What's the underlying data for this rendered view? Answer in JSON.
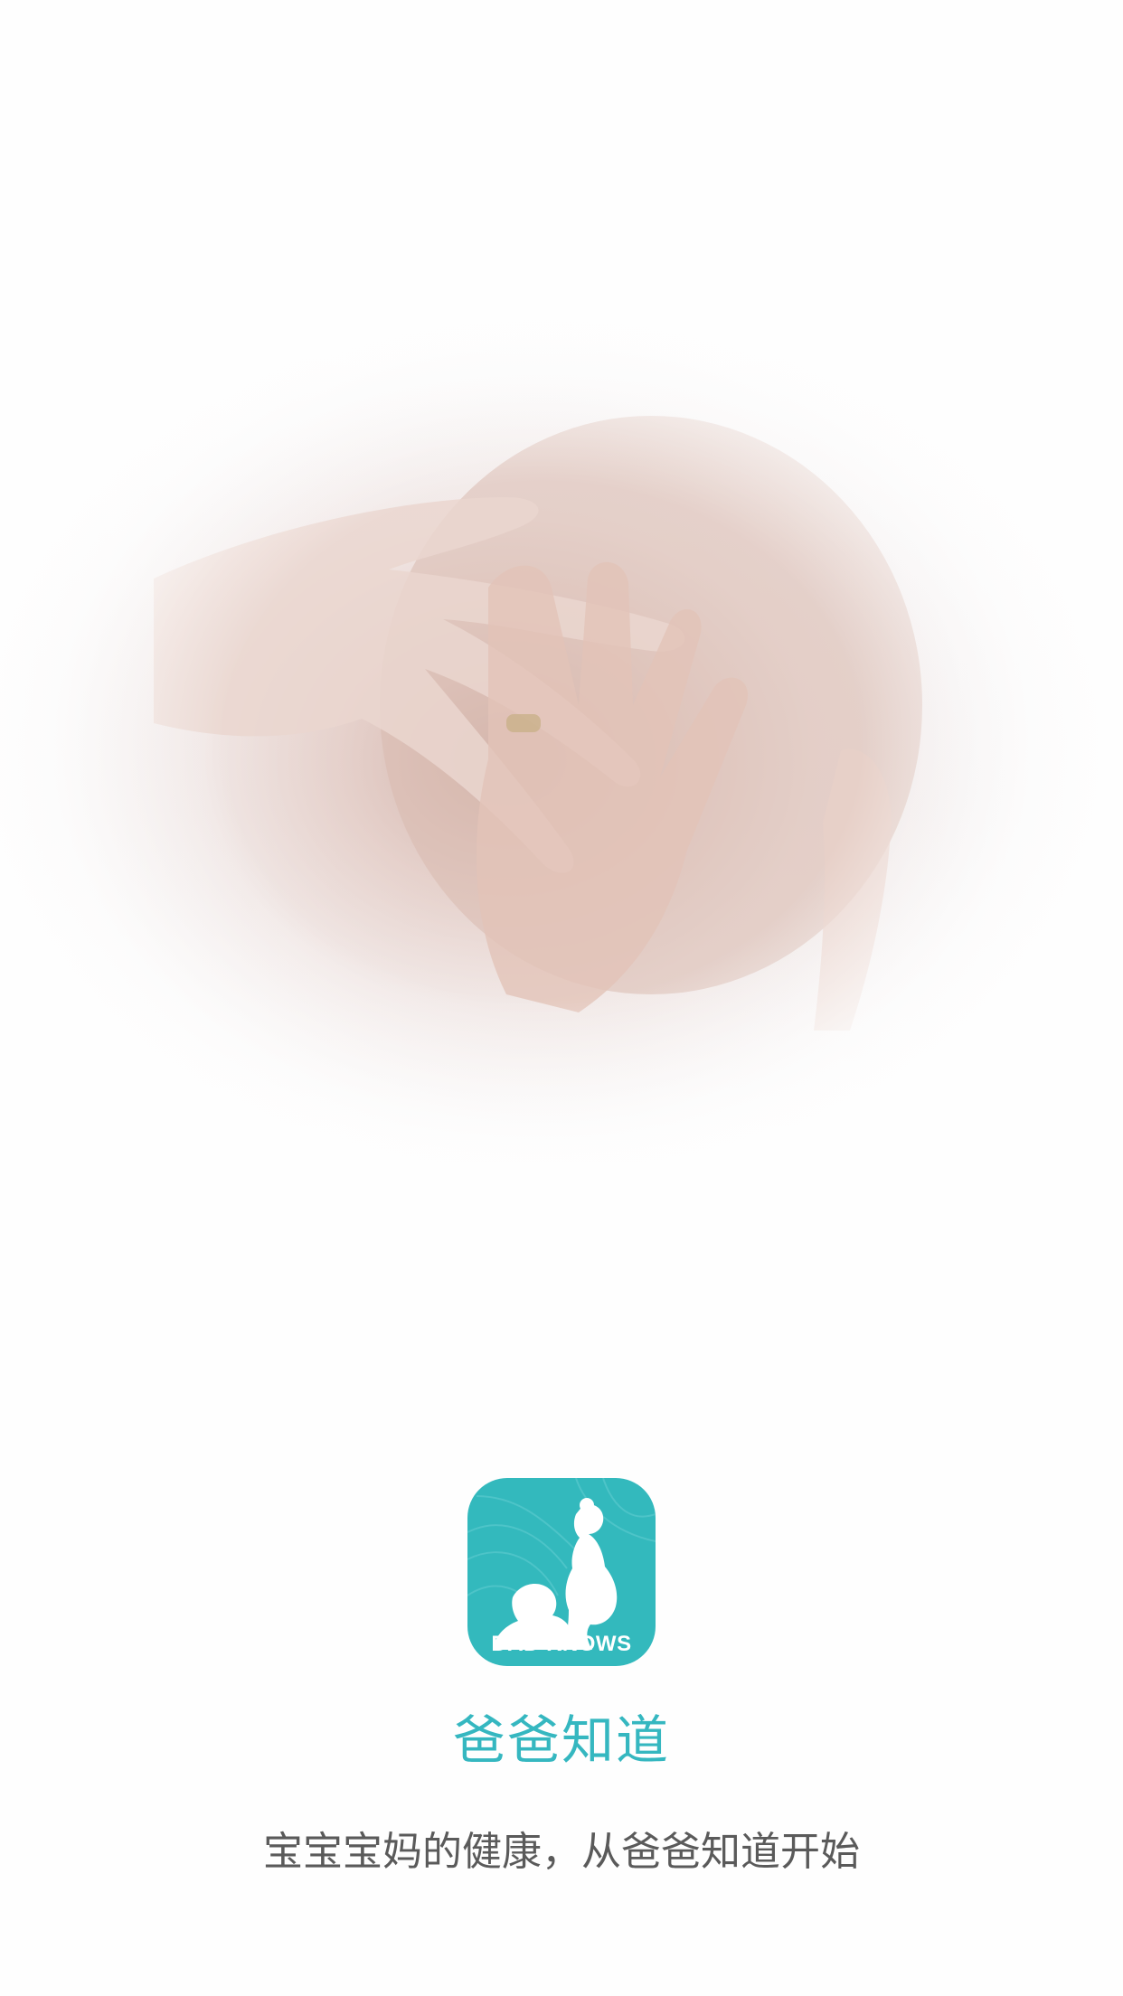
{
  "splash": {
    "hero_image": "pregnant-belly-hands-photo",
    "logo": {
      "text": "DAD KNOWS",
      "bg_color": "#33b9bd"
    },
    "app_name": "爸爸知道",
    "slogan": "宝宝宝妈的健康，从爸爸知道开始",
    "colors": {
      "accent": "#35b7c0",
      "slogan": "#5a5a5a",
      "background": "#fefefe"
    }
  }
}
